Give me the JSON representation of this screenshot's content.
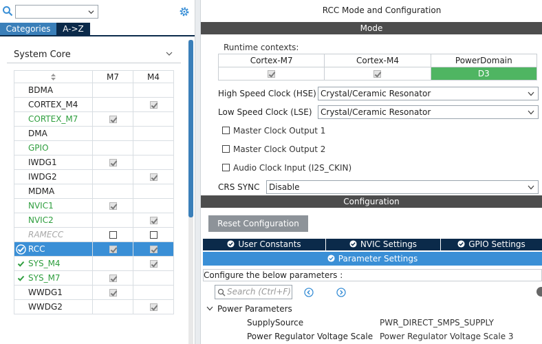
{
  "left": {
    "search": {
      "value": ""
    },
    "tabs": [
      {
        "label": "Categories"
      },
      {
        "label": "A->Z"
      }
    ],
    "category": {
      "label": "System Core"
    },
    "columns": {
      "m7": "M7",
      "m4": "M4"
    },
    "rows": [
      {
        "name": "BDMA",
        "m7": "none",
        "m4": "none",
        "color": "normal",
        "status": ""
      },
      {
        "name": "CORTEX_M4",
        "m7": "none",
        "m4": "checked",
        "color": "normal",
        "status": ""
      },
      {
        "name": "CORTEX_M7",
        "m7": "checked",
        "m4": "none",
        "color": "green",
        "status": ""
      },
      {
        "name": "DMA",
        "m7": "none",
        "m4": "none",
        "color": "normal",
        "status": ""
      },
      {
        "name": "GPIO",
        "m7": "none",
        "m4": "none",
        "color": "green",
        "status": ""
      },
      {
        "name": "IWDG1",
        "m7": "checked",
        "m4": "none",
        "color": "normal",
        "status": ""
      },
      {
        "name": "IWDG2",
        "m7": "none",
        "m4": "checked",
        "color": "normal",
        "status": ""
      },
      {
        "name": "MDMA",
        "m7": "none",
        "m4": "none",
        "color": "normal",
        "status": ""
      },
      {
        "name": "NVIC1",
        "m7": "checked",
        "m4": "none",
        "color": "green",
        "status": ""
      },
      {
        "name": "NVIC2",
        "m7": "none",
        "m4": "checked",
        "color": "green",
        "status": ""
      },
      {
        "name": "RAMECC",
        "m7": "unchecked",
        "m4": "unchecked",
        "color": "grey",
        "status": ""
      },
      {
        "name": "RCC",
        "m7": "checked",
        "m4": "checked",
        "color": "selected",
        "status": "ok"
      },
      {
        "name": "SYS_M4",
        "m7": "none",
        "m4": "checked",
        "color": "green",
        "status": "ok"
      },
      {
        "name": "SYS_M7",
        "m7": "checked",
        "m4": "none",
        "color": "green",
        "status": "ok"
      },
      {
        "name": "WWDG1",
        "m7": "checked",
        "m4": "none",
        "color": "normal",
        "status": ""
      },
      {
        "name": "WWDG2",
        "m7": "none",
        "m4": "checked",
        "color": "normal",
        "status": ""
      }
    ]
  },
  "right": {
    "title": "RCC Mode and Configuration",
    "mode_band": "Mode",
    "runtime_label": "Runtime contexts:",
    "contexts": [
      {
        "label": "Cortex-M7",
        "value": "checked"
      },
      {
        "label": "Cortex-M4",
        "value": "checked"
      },
      {
        "label": "PowerDomain",
        "value": "D3"
      }
    ],
    "hse": {
      "label": "High Speed Clock (HSE)",
      "value": "Crystal/Ceramic Resonator"
    },
    "lse": {
      "label": "Low Speed Clock (LSE)",
      "value": "Crystal/Ceramic Resonator"
    },
    "options": [
      {
        "label": "Master Clock Output 1"
      },
      {
        "label": "Master Clock Output 2"
      },
      {
        "label": "Audio Clock Input (I2S_CKIN)"
      }
    ],
    "crs": {
      "label": "CRS SYNC",
      "value": "Disable"
    },
    "config_band": "Configuration",
    "reset_label": "Reset Configuration",
    "tabs": {
      "user": "User Constants",
      "nvic": "NVIC Settings",
      "gpio": "GPIO Settings",
      "param": "Parameter Settings"
    },
    "description": "Configure the below parameters :",
    "search_placeholder": "Search (Ctrl+F)",
    "group": "Power Parameters",
    "params": [
      {
        "name": "SupplySource",
        "value": "PWR_DIRECT_SMPS_SUPPLY"
      },
      {
        "name": "Power Regulator Voltage Scale",
        "value": "Power Regulator Voltage Scale 3"
      }
    ]
  },
  "colors": {
    "accent": "#3a8fd6",
    "navy": "#0b2a4a",
    "green": "#2e9e3e",
    "band": "#4d4d4d",
    "active": "#4fb562"
  }
}
